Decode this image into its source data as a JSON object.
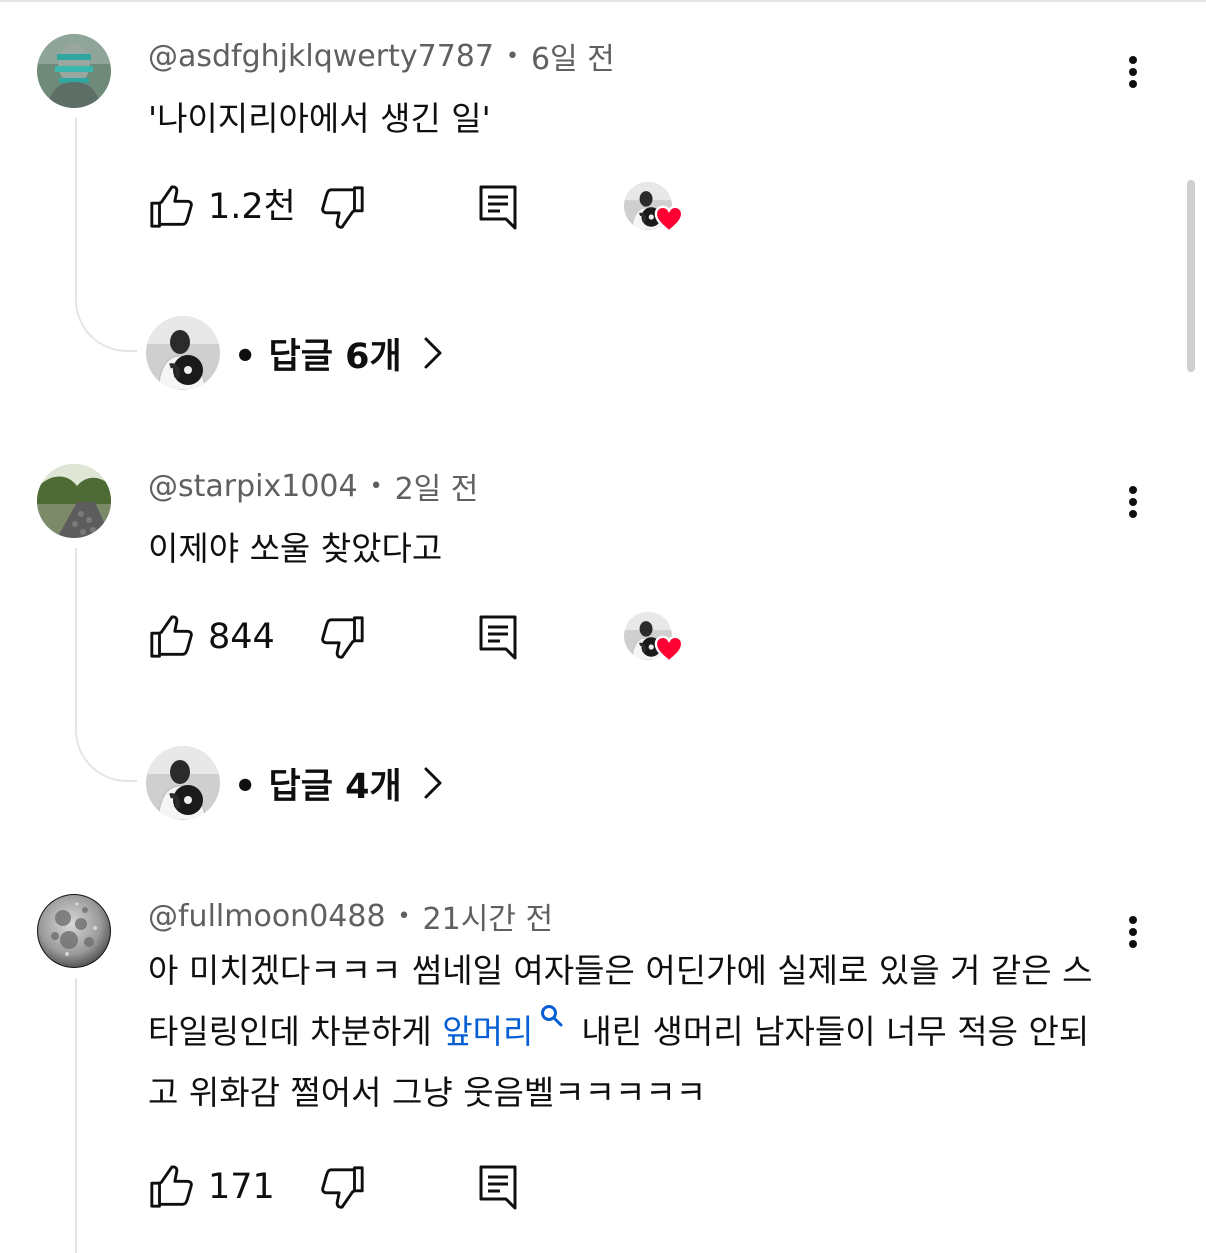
{
  "comments": [
    {
      "handle": "@asdfghjklqwerty7787",
      "separator": "•",
      "time": "6일 전",
      "text": "'나이지리아에서 생긴 일'",
      "likes": "1.2천",
      "creator_hearted": true,
      "replies_label": "• 답글 6개",
      "avatar_icon": "portrait-avatar-icon"
    },
    {
      "handle": "@starpix1004",
      "separator": "•",
      "time": "2일 전",
      "text": "이제야 쏘울 찾았다고",
      "likes": "844",
      "creator_hearted": true,
      "replies_label": "• 답글 4개",
      "avatar_icon": "landscape-avatar-icon"
    },
    {
      "handle": "@fullmoon0488",
      "separator": "•",
      "time": "21시간 전",
      "text_before": "아 미치겠다ㅋㅋㅋ 썸네일 여자들은 어딘가에 실제로 있을 거 같은 스타일링인데 차분하게 ",
      "text_link": "앞머리",
      "text_after": "내린 생머리 남자들이 너무 적응 안되고 위화감 쩔어서 그냥 웃음벨ㅋㅋㅋㅋㅋ",
      "likes": "171",
      "creator_hearted": false,
      "avatar_icon": "moon-avatar-icon"
    }
  ],
  "colors": {
    "text": "#0f0f0f",
    "secondary": "#606060",
    "link": "#065fd4",
    "heart": "#ff0033",
    "divider": "#e5e5e5"
  },
  "icons": [
    "like-icon",
    "dislike-icon",
    "reply-icon",
    "more-vert-icon",
    "heart-icon",
    "chevron-right-icon",
    "search-icon"
  ]
}
